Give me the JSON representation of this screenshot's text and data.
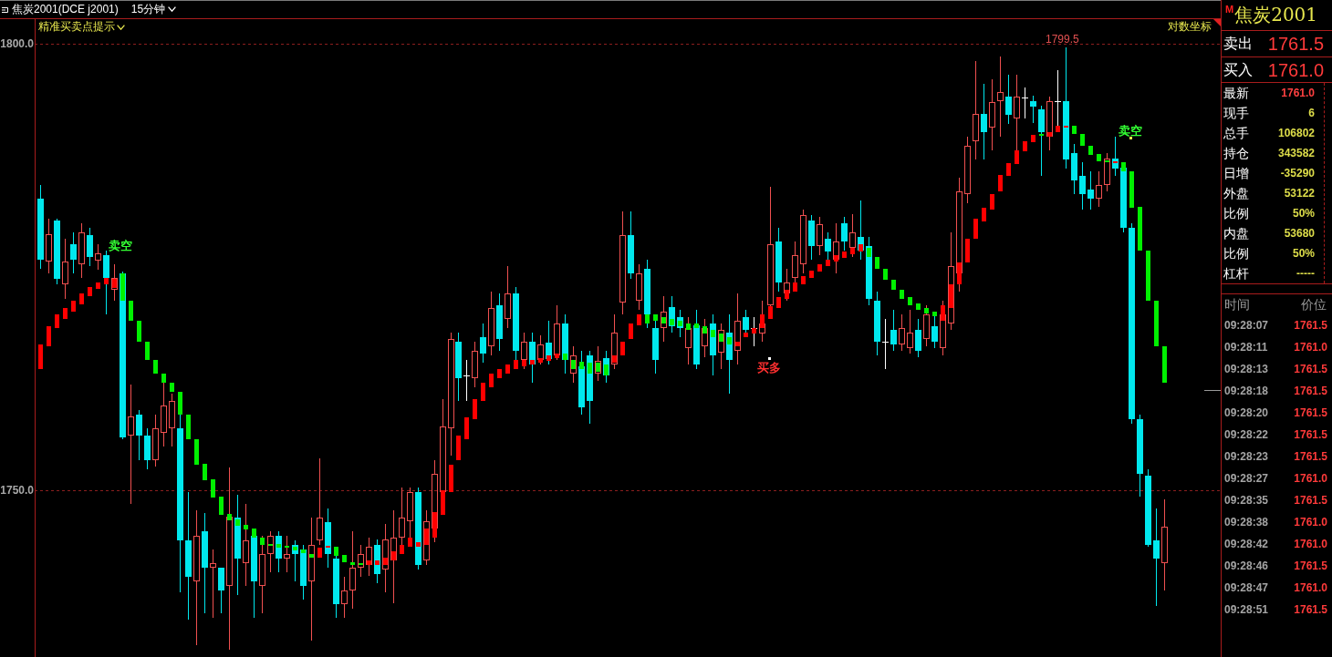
{
  "title_bar": {
    "instrument": "焦炭2001(DCE j2001)",
    "period": "15分钟"
  },
  "chart": {
    "indicator": "精准买卖点提示",
    "scale_mode": "对数坐标",
    "y_axis": [
      "1800.0",
      "1750.0"
    ],
    "high_label": "1799.5",
    "signals": [
      {
        "kind": "sell",
        "text": "卖空"
      },
      {
        "kind": "buy",
        "text": "买多"
      },
      {
        "kind": "sell",
        "text": "卖空"
      }
    ]
  },
  "quote_panel": {
    "market_flag": "M",
    "name": "焦炭2001",
    "ask": {
      "label": "卖出",
      "value": "1761.5"
    },
    "bid": {
      "label": "买入",
      "value": "1761.0"
    },
    "stats": [
      {
        "label": "最新",
        "value": "1761.0",
        "color": "#ff4040"
      },
      {
        "label": "现手",
        "value": "6",
        "color": "#dede4a"
      },
      {
        "label": "总手",
        "value": "106802",
        "color": "#dede4a"
      },
      {
        "label": "持仓",
        "value": "343582",
        "color": "#dede4a"
      },
      {
        "label": "日增",
        "value": "-35290",
        "color": "#dede4a"
      },
      {
        "label": "外盘",
        "value": "53122",
        "color": "#dede4a"
      },
      {
        "label": "比例",
        "value": "50%",
        "color": "#dede4a"
      },
      {
        "label": "内盘",
        "value": "53680",
        "color": "#dede4a"
      },
      {
        "label": "比例",
        "value": "50%",
        "color": "#dede4a"
      },
      {
        "label": "杠杆",
        "value": "-----",
        "color": "#dede4a"
      }
    ]
  },
  "ticks": {
    "columns": [
      "时间",
      "价位"
    ],
    "rows": [
      {
        "time": "09:28:07",
        "price": "1761.5"
      },
      {
        "time": "09:28:11",
        "price": "1761.0"
      },
      {
        "time": "09:28:13",
        "price": "1761.5"
      },
      {
        "time": "09:28:18",
        "price": "1761.5"
      },
      {
        "time": "09:28:20",
        "price": "1761.5"
      },
      {
        "time": "09:28:22",
        "price": "1761.5"
      },
      {
        "time": "09:28:23",
        "price": "1761.5"
      },
      {
        "time": "09:28:27",
        "price": "1761.0"
      },
      {
        "time": "09:28:35",
        "price": "1761.5"
      },
      {
        "time": "09:28:38",
        "price": "1761.0"
      },
      {
        "time": "09:28:42",
        "price": "1761.0"
      },
      {
        "time": "09:28:46",
        "price": "1761.5"
      },
      {
        "time": "09:28:47",
        "price": "1761.0"
      },
      {
        "time": "09:28:51",
        "price": "1761.5"
      }
    ]
  }
}
